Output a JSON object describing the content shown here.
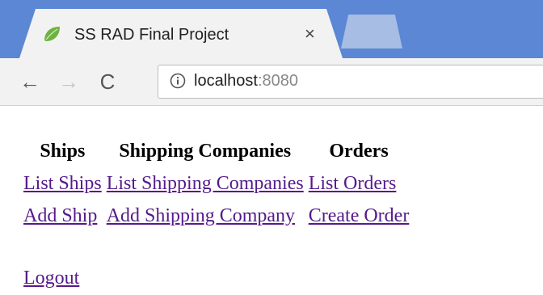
{
  "browser": {
    "tab": {
      "title": "SS RAD Final Project",
      "close": "×"
    },
    "toolbar": {
      "back": "←",
      "forward": "→",
      "reload": "C",
      "url_host": "localhost",
      "url_port": ":8080"
    },
    "colors": {
      "tabstrip": "#5b87d4",
      "tab_active": "#f2f2f2",
      "visited_link": "#551a8b"
    }
  },
  "page": {
    "columns": [
      {
        "header": "Ships",
        "links": [
          "List Ships",
          "Add Ship"
        ]
      },
      {
        "header": "Shipping Companies",
        "links": [
          "List Shipping Companies",
          "Add Shipping Company"
        ]
      },
      {
        "header": "Orders",
        "links": [
          "List Orders",
          "Create Order"
        ]
      }
    ],
    "logout": "Logout"
  }
}
